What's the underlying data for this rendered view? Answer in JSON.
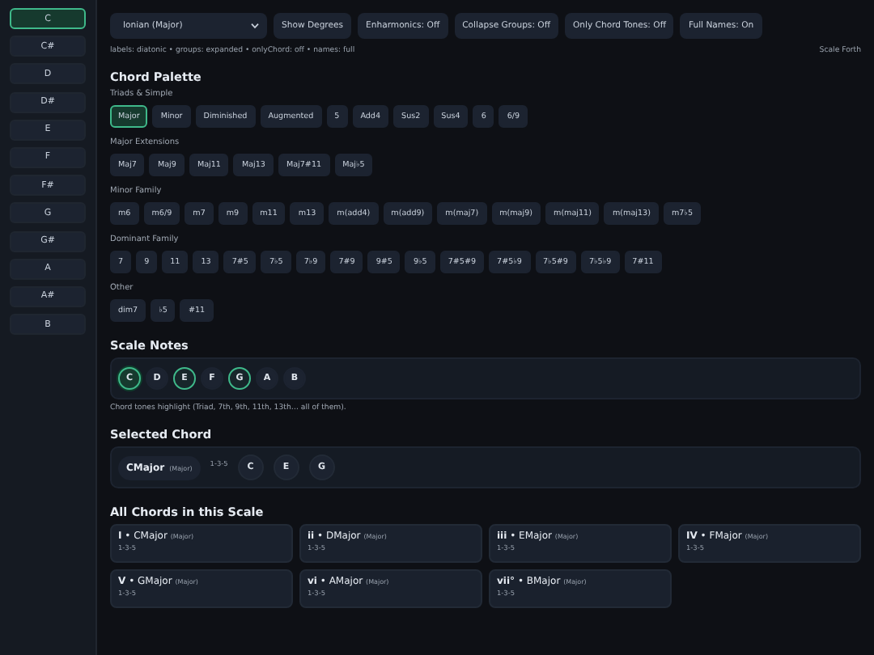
{
  "sidebar": {
    "items": [
      {
        "label": "C",
        "selected": true
      },
      {
        "label": "C#",
        "selected": false
      },
      {
        "label": "D",
        "selected": false
      },
      {
        "label": "D#",
        "selected": false
      },
      {
        "label": "E",
        "selected": false
      },
      {
        "label": "F",
        "selected": false
      },
      {
        "label": "F#",
        "selected": false
      },
      {
        "label": "G",
        "selected": false
      },
      {
        "label": "G#",
        "selected": false
      },
      {
        "label": "A",
        "selected": false
      },
      {
        "label": "A#",
        "selected": false
      },
      {
        "label": "B",
        "selected": false
      }
    ]
  },
  "toolbar": {
    "mode_select": "Ionian (Major)",
    "buttons": [
      "Show Degrees",
      "Enharmonics: Off",
      "Collapse Groups: Off",
      "Only Chord Tones: Off",
      "Full Names: On"
    ],
    "status": "labels: diatonic • groups: expanded • onlyChord: off • names: full",
    "scale_label": "Scale Forth"
  },
  "palette": {
    "title": "Chord Palette",
    "groups": [
      {
        "title": "Triads & Simple",
        "chords": [
          {
            "label": "Major",
            "selected": true
          },
          {
            "label": "Minor",
            "selected": false
          },
          {
            "label": "Diminished",
            "selected": false
          },
          {
            "label": "Augmented",
            "selected": false
          },
          {
            "label": "5",
            "selected": false
          },
          {
            "label": "Add4",
            "selected": false
          },
          {
            "label": "Sus2",
            "selected": false
          },
          {
            "label": "Sus4",
            "selected": false
          },
          {
            "label": "6",
            "selected": false
          },
          {
            "label": "6/9",
            "selected": false
          }
        ]
      },
      {
        "title": "Major Extensions",
        "chords": [
          {
            "label": "Maj7",
            "selected": false
          },
          {
            "label": "Maj9",
            "selected": false
          },
          {
            "label": "Maj11",
            "selected": false
          },
          {
            "label": "Maj13",
            "selected": false
          },
          {
            "label": "Maj7#11",
            "selected": false
          },
          {
            "label": "Maj♭5",
            "selected": false
          }
        ]
      },
      {
        "title": "Minor Family",
        "chords": [
          {
            "label": "m6",
            "selected": false
          },
          {
            "label": "m6/9",
            "selected": false
          },
          {
            "label": "m7",
            "selected": false
          },
          {
            "label": "m9",
            "selected": false
          },
          {
            "label": "m11",
            "selected": false
          },
          {
            "label": "m13",
            "selected": false
          },
          {
            "label": "m(add4)",
            "selected": false
          },
          {
            "label": "m(add9)",
            "selected": false
          },
          {
            "label": "m(maj7)",
            "selected": false
          },
          {
            "label": "m(maj9)",
            "selected": false
          },
          {
            "label": "m(maj11)",
            "selected": false
          },
          {
            "label": "m(maj13)",
            "selected": false
          },
          {
            "label": "m7♭5",
            "selected": false
          }
        ]
      },
      {
        "title": "Dominant Family",
        "chords": [
          {
            "label": "7",
            "selected": false
          },
          {
            "label": "9",
            "selected": false
          },
          {
            "label": "11",
            "selected": false
          },
          {
            "label": "13",
            "selected": false
          },
          {
            "label": "7#5",
            "selected": false
          },
          {
            "label": "7♭5",
            "selected": false
          },
          {
            "label": "7♭9",
            "selected": false
          },
          {
            "label": "7#9",
            "selected": false
          },
          {
            "label": "9#5",
            "selected": false
          },
          {
            "label": "9♭5",
            "selected": false
          },
          {
            "label": "7#5#9",
            "selected": false
          },
          {
            "label": "7#5♭9",
            "selected": false
          },
          {
            "label": "7♭5#9",
            "selected": false
          },
          {
            "label": "7♭5♭9",
            "selected": false
          },
          {
            "label": "7#11",
            "selected": false
          }
        ]
      },
      {
        "title": "Other",
        "chords": [
          {
            "label": "dim7",
            "selected": false
          },
          {
            "label": "♭5",
            "selected": false
          },
          {
            "label": "#11",
            "selected": false
          }
        ]
      }
    ]
  },
  "scale_notes": {
    "title": "Scale Notes",
    "notes": [
      {
        "label": "C",
        "in_chord": true,
        "root": true
      },
      {
        "label": "D",
        "in_chord": false,
        "root": false
      },
      {
        "label": "E",
        "in_chord": true,
        "root": false
      },
      {
        "label": "F",
        "in_chord": false,
        "root": false
      },
      {
        "label": "G",
        "in_chord": true,
        "root": false
      },
      {
        "label": "A",
        "in_chord": false,
        "root": false
      },
      {
        "label": "B",
        "in_chord": false,
        "root": false
      }
    ],
    "caption": "Chord tones highlight (Triad, 7th, 9th, 11th, 13th… all of them)."
  },
  "selected_chord": {
    "title": "Selected Chord",
    "name": "CMajor",
    "quality": "(Major)",
    "formula": "1-3-5",
    "notes": [
      "C",
      "E",
      "G"
    ]
  },
  "all_chords": {
    "title": "All Chords in this Scale",
    "chords": [
      {
        "title": "**I** • CMajor",
        "quality": "(Major)",
        "formula": "1-3-5"
      },
      {
        "title": "**ii** • DMajor",
        "quality": "(Major)",
        "formula": "1-3-5"
      },
      {
        "title": "**iii** • EMajor",
        "quality": "(Major)",
        "formula": "1-3-5"
      },
      {
        "title": "**IV** • FMajor",
        "quality": "(Major)",
        "formula": "1-3-5"
      },
      {
        "title": "**V** • GMajor",
        "quality": "(Major)",
        "formula": "1-3-5"
      },
      {
        "title": "**vi** • AMajor",
        "quality": "(Major)",
        "formula": "1-3-5"
      },
      {
        "title": "**vii°** • BMajor",
        "quality": "(Major)",
        "formula": "1-3-5"
      }
    ]
  }
}
